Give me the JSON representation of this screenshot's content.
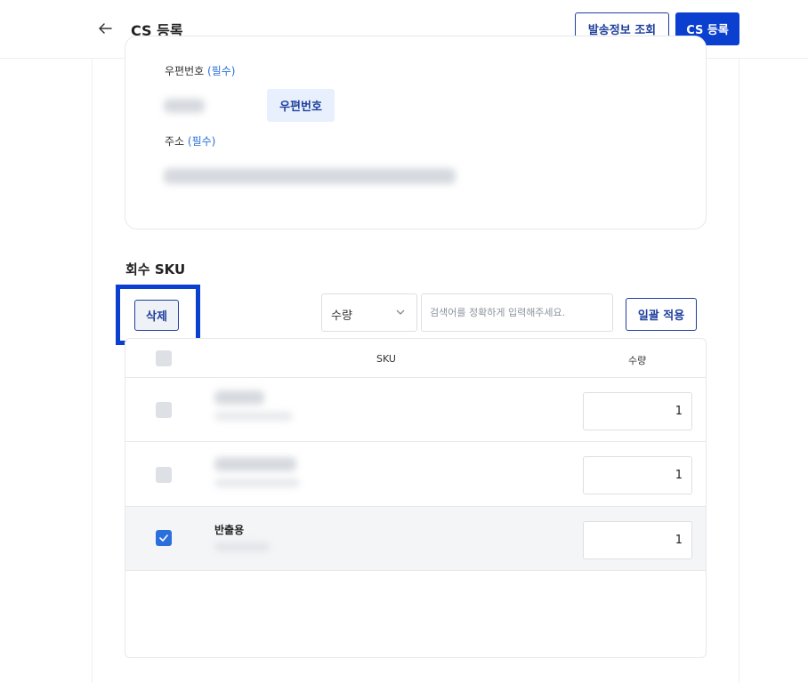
{
  "header": {
    "title": "CS 등록",
    "lookup_button": "발송정보 조회",
    "register_button": "CS 등록"
  },
  "address": {
    "postcode_label": "우편번호",
    "postcode_required": "(필수)",
    "postcode_button": "우편번호",
    "address_label": "주소",
    "address_required": "(필수)"
  },
  "recovery": {
    "section_title": "회수 SKU",
    "delete_button": "삭제",
    "select_value": "수량",
    "search_placeholder": "검색어를 정확하게 입력해주세요.",
    "apply_button": "일괄 적용",
    "columns": [
      "SKU",
      "수량"
    ],
    "rows": [
      {
        "name": "",
        "quantity": "1",
        "checked": false
      },
      {
        "name": "",
        "quantity": "1",
        "checked": false
      },
      {
        "name": "반출용",
        "quantity": "1",
        "checked": true
      }
    ]
  },
  "colors": {
    "accent": "#0a3fcf",
    "brand_text": "#1f3f9e",
    "required": "#2a6fdb",
    "checkbox_checked": "#2a6fdb"
  },
  "icons": {
    "back": "arrow-left-icon",
    "select": "chevron-down-icon",
    "check": "check-icon"
  }
}
